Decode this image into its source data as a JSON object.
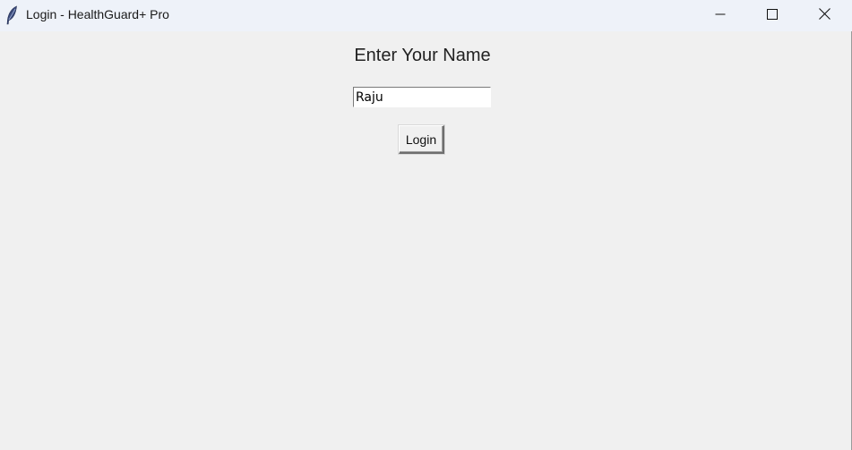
{
  "window": {
    "title": "Login - HealthGuard+ Pro",
    "app_icon": "feather-icon",
    "controls": {
      "minimize_icon": "minimize-icon",
      "maximize_icon": "maximize-icon",
      "close_icon": "close-icon"
    }
  },
  "form": {
    "heading": "Enter Your Name",
    "name_value": "Raju",
    "login_label": "Login"
  },
  "colors": {
    "background": "#f0f0f0",
    "titlebar": "#eef2f9",
    "input_background": "#ffffff"
  }
}
